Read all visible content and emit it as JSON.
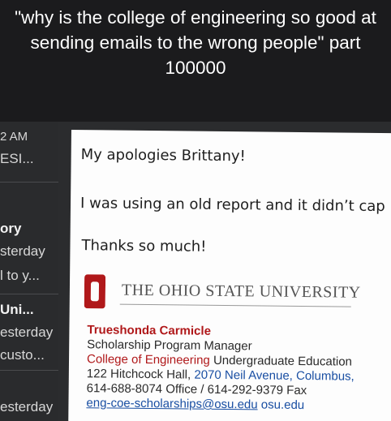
{
  "caption": {
    "line1": "\"why is the college of engineering so good at",
    "line2": "sending emails to the wrong people\" part",
    "line3": "100000"
  },
  "sidebar": {
    "items": [
      {
        "text": "2 AM"
      },
      {
        "text": "ESI..."
      },
      {
        "text": "ory"
      },
      {
        "text": "sterday"
      },
      {
        "text": "l to y..."
      },
      {
        "text": "Uni..."
      },
      {
        "text": "esterday"
      },
      {
        "text": "custo..."
      },
      {
        "text": "esterday"
      }
    ]
  },
  "email": {
    "greeting": "My apologies Brittany!",
    "body": "I was using an old report and it didn’t cap",
    "thanks": "Thanks so much!",
    "university": "THE OHIO STATE UNIVERSITY",
    "signature": {
      "name": "Trueshonda Carmicle",
      "title": "Scholarship Program Manager",
      "college": "College of Engineering",
      "dept": "Undergraduate Education",
      "address_room": "122 Hitchcock Hall,",
      "address_street": "2070 Neil Avenue, Columbus,",
      "phone": "614-688-8074 Office / 614-292-9379 Fax",
      "email": "eng-coe-scholarships@osu.edu",
      "site": "osu.edu"
    }
  },
  "colors": {
    "brand_red": "#b0181a",
    "link_blue": "#1a4fa3"
  }
}
